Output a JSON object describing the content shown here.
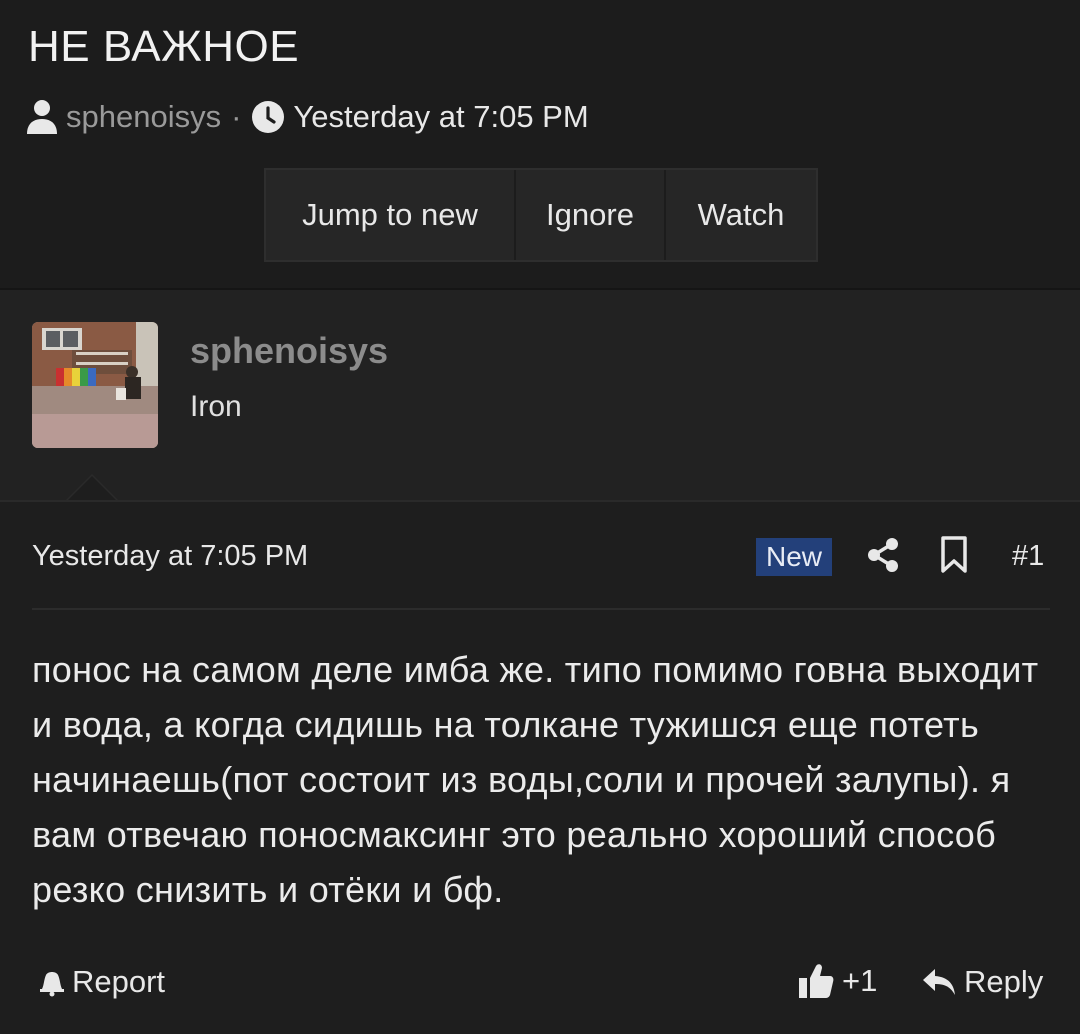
{
  "thread": {
    "title": "НЕ ВАЖНОЕ",
    "author": "sphenoisys",
    "separator": "·",
    "date": "Yesterday at 7:05 PM"
  },
  "actions": {
    "jump_to_new": "Jump to new",
    "ignore": "Ignore",
    "watch": "Watch"
  },
  "post_author": {
    "name": "sphenoisys",
    "title": "Iron"
  },
  "post": {
    "date": "Yesterday at 7:05 PM",
    "badge": "New",
    "number": "#1",
    "body": "понос на самом деле имба же. типо помимо говна выходит и вода, а когда сидишь на толкане тужишся еще потеть начинаешь(пот состоит из воды,соли и прочей залупы). я вам отвечаю поносмаксинг это реально хороший способ резко снизить и отёки и бф.",
    "report_label": "Report",
    "like_count": "+1",
    "reply_label": "Reply"
  },
  "colors": {
    "background": "#1c1c1c",
    "author_block": "#222222",
    "badge_new": "#23407a"
  },
  "icons": [
    "user-icon",
    "clock-icon",
    "share-icon",
    "bookmark-icon",
    "warning-icon",
    "thumbs-up-icon",
    "reply-icon"
  ]
}
